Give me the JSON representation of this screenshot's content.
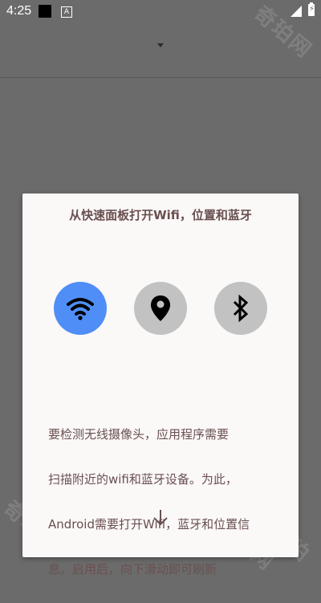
{
  "statusbar": {
    "time": "4:25",
    "notification_icon_label": "A",
    "battery_glyph": "⚡"
  },
  "watermark": {
    "text": "奇珀网"
  },
  "dialog": {
    "title": "从快速面板打开Wifi，位置和蓝牙",
    "buttons": [
      {
        "name": "wifi",
        "icon": "wifi-icon",
        "state": "on",
        "color": "#4f8ef7"
      },
      {
        "name": "location",
        "icon": "location-pin-icon",
        "state": "off",
        "color": "#c2c2c2"
      },
      {
        "name": "bluetooth",
        "icon": "bluetooth-icon",
        "state": "off",
        "color": "#c2c2c2"
      }
    ],
    "body_lines": [
      "要检测无线摄像头，应用程序需要",
      "扫描附近的wifi和蓝牙设备。为此，",
      "Android需要打开Wifi，蓝牙和位置信",
      "息。启用后，向下滑动即可刷新"
    ],
    "scroll_hint_icon": "arrow-down-icon"
  },
  "colors": {
    "scrim": "#6b6b6b",
    "dialog_bg": "#fbf8f8",
    "text": "#6a5050",
    "wifi_active": "#4f8ef7",
    "inactive_button": "#c2c2c2"
  }
}
